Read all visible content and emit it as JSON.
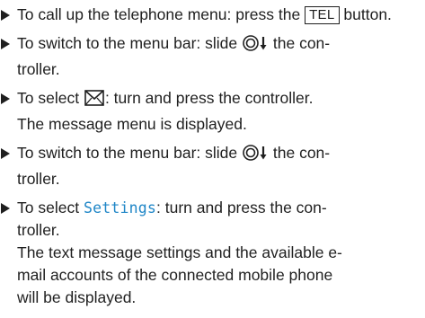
{
  "colors": {
    "text": "#1f1f1f",
    "accent": "#1f86c7"
  },
  "steps": [
    {
      "pre": "To call up the telephone menu: press the",
      "key": "TEL",
      "post": "button."
    },
    {
      "pre": "To switch to the menu bar: slide",
      "icon": "controller-slide-down-icon",
      "post": "the con-",
      "line2": "troller."
    },
    {
      "pre": "To select",
      "icon": "envelope-icon",
      "post": ": turn and press the controller.",
      "line2": "The message menu is displayed."
    },
    {
      "pre": "To switch to the menu bar: slide",
      "icon": "controller-slide-down-icon",
      "post": "the con-",
      "line2": "troller."
    },
    {
      "pre": "To select",
      "highlight": "Settings",
      "post": ": turn and press the con-",
      "line2": "troller.",
      "line3": "The text message settings and the available e-",
      "line4": "mail accounts of the connected mobile phone",
      "line5": "will be displayed."
    }
  ]
}
